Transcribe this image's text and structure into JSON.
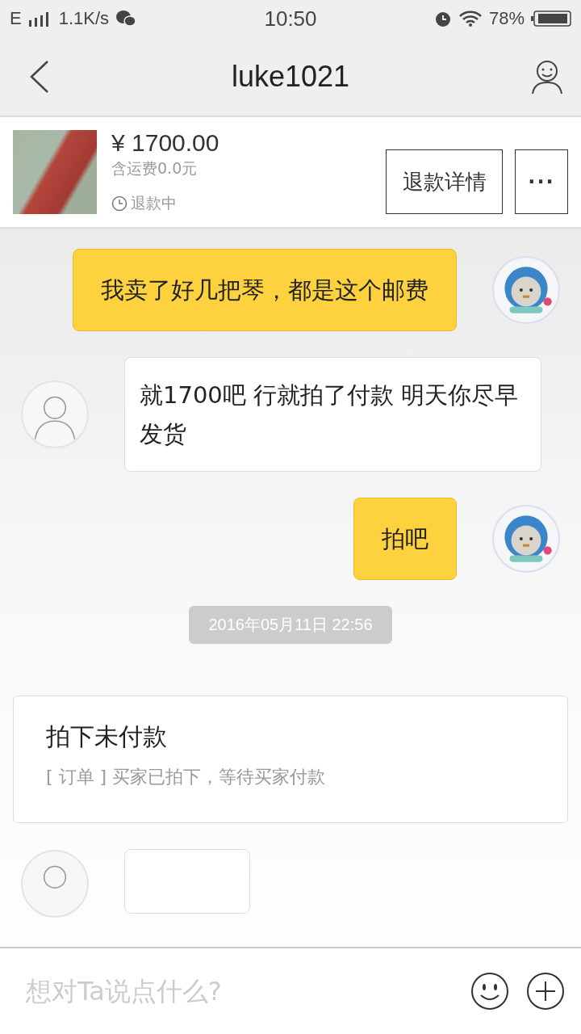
{
  "status_bar": {
    "network": "E",
    "speed": "1.1K/s",
    "time": "10:50",
    "battery": "78%"
  },
  "header": {
    "title": "luke1021"
  },
  "product": {
    "price": "¥ 1700.00",
    "shipping": "含运费0.0元",
    "status": "退款中",
    "buttons": [
      "退款详情",
      "···"
    ]
  },
  "messages": [
    {
      "kind": "sent",
      "text": "我卖了好几把琴，都是这个邮费"
    },
    {
      "kind": "received",
      "text": "就1700吧   行就拍了付款  明天你尽早发货"
    },
    {
      "kind": "sent",
      "text": "拍吧"
    },
    {
      "kind": "time",
      "text": "2016年05月11日 22:56"
    },
    {
      "kind": "card",
      "title": "拍下未付款",
      "text": "[ 订单 ] 买家已拍下，等待买家付款"
    },
    {
      "kind": "partial"
    }
  ],
  "input": {
    "placeholder": "想对Ta说点什么?"
  }
}
